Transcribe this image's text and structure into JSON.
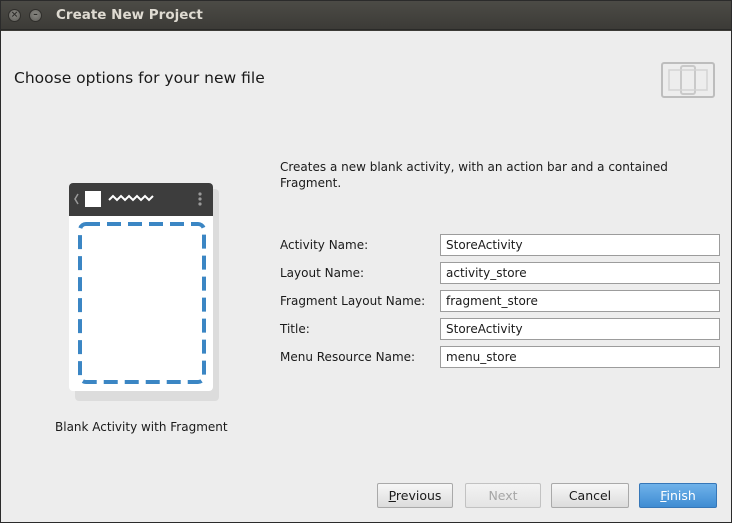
{
  "window": {
    "title": "Create New Project"
  },
  "header": {
    "title": "Choose options for your new file",
    "icon": "device-layout-icon"
  },
  "preview": {
    "caption": "Blank Activity with Fragment",
    "icon": "blank-activity-fragment-preview"
  },
  "description": "Creates a new blank activity, with an action bar and a contained Fragment.",
  "form": {
    "fields": [
      {
        "label": "Activity Name:",
        "value": "StoreActivity"
      },
      {
        "label": "Layout Name:",
        "value": "activity_store"
      },
      {
        "label": "Fragment Layout Name:",
        "value": "fragment_store"
      },
      {
        "label": "Title:",
        "value": "StoreActivity"
      },
      {
        "label": "Menu Resource Name:",
        "value": "menu_store"
      }
    ]
  },
  "buttons": {
    "previous": {
      "mnemonic": "P",
      "rest": "revious"
    },
    "next": {
      "label": "Next"
    },
    "cancel": {
      "label": "Cancel"
    },
    "finish": {
      "mnemonic": "F",
      "rest": "inish"
    }
  },
  "colors": {
    "finish_accent": "#3f8cd2",
    "dashed_fragment": "#3b86c4",
    "titlebar": "#3c3b37"
  }
}
